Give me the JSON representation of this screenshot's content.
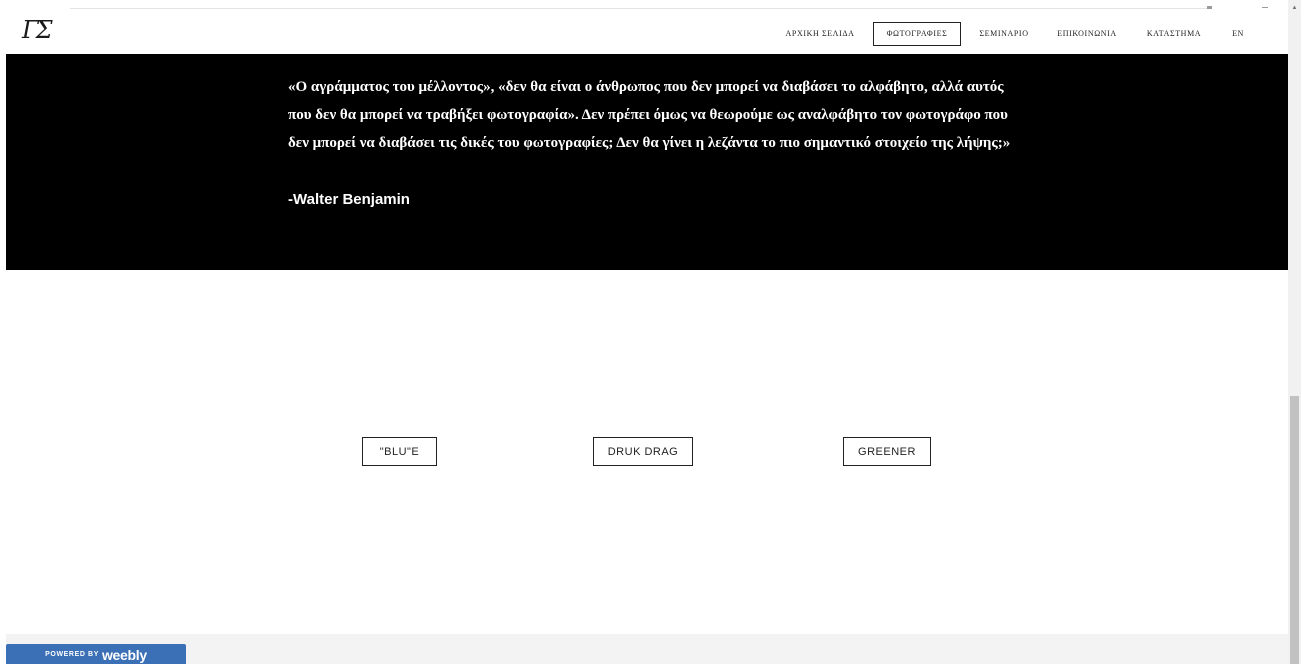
{
  "header": {
    "logo_text": "ΓΣ",
    "nav": [
      {
        "label": "ΑΡΧΙΚΗ ΣΕΛΙΔΑ",
        "active": false
      },
      {
        "label": "ΦΩΤΟΓΡΑΦΙΕΣ",
        "active": true
      },
      {
        "label": "ΣΕΜΙΝΑΡΙΟ",
        "active": false
      },
      {
        "label": "ΕΠΙΚΟΙΝΩΝΙΑ",
        "active": false
      },
      {
        "label": "ΚΑΤΑΣΤΗΜΑ",
        "active": false
      },
      {
        "label": "EN",
        "active": false
      }
    ]
  },
  "hero": {
    "quote": "«Ο αγράμματος του μέλλοντος», «δεν θα είναι ο άνθρωπος που δεν μπορεί να διαβάσει το αλφάβητο, αλλά αυτός που δεν θα μπορεί να τραβήξει φωτογραφία». Δεν πρέπει όμως να θεωρούμε ως αναλφάβητο τον φωτογράφο που δεν μπορεί να διαβάσει τις δικές του φωτογραφίες; Δεν θα γίνει η λεζάντα το πιο σημαντικό στοιχείο της λήψης;»",
    "author": "-Walter Benjamin",
    "background": "#000000"
  },
  "gallery": {
    "buttons": [
      {
        "label": "\"BLU\"E"
      },
      {
        "label": "DRUK DRAG"
      },
      {
        "label": "GREENER"
      }
    ]
  },
  "footer": {
    "badge_powered": "POWERED BY",
    "badge_brand": "weebly",
    "badge_color": "#3b6fb6"
  },
  "scrollbar": {
    "arrow_icon": "scroll-up-arrow"
  }
}
